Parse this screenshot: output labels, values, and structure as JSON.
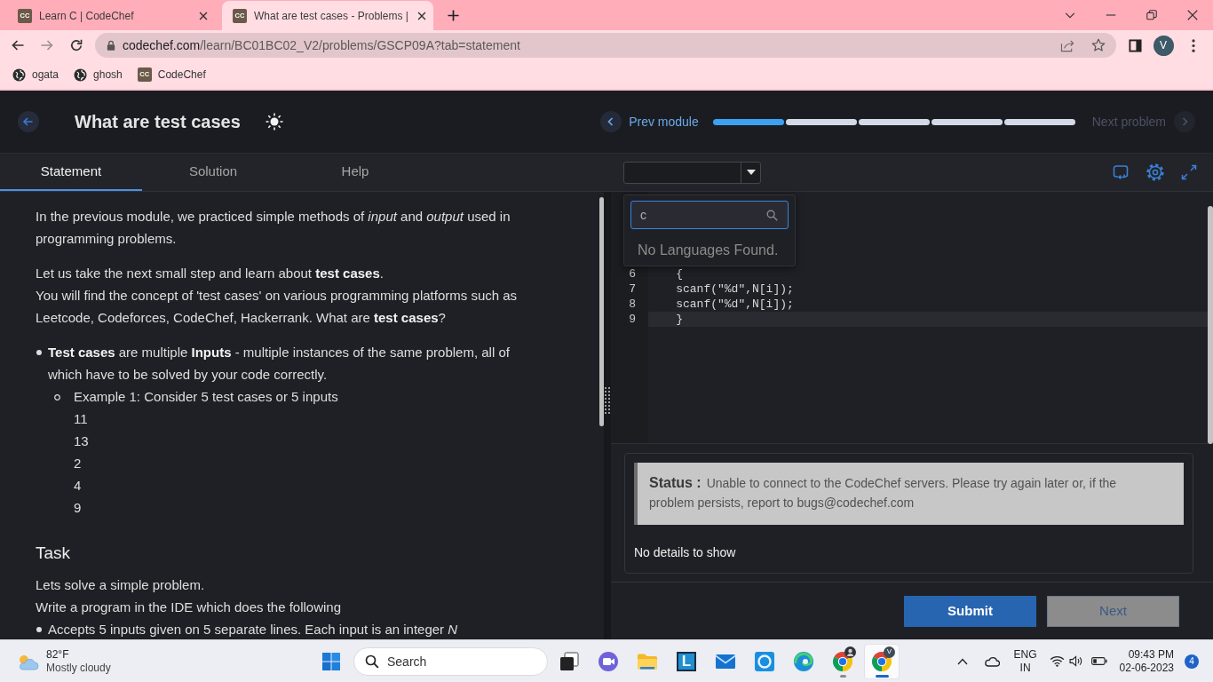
{
  "browser": {
    "tabs": [
      {
        "favicon": "CC",
        "title": "Learn C | CodeChef",
        "selected": false
      },
      {
        "favicon": "CC",
        "title": "What are test cases - Problems |",
        "selected": true
      }
    ],
    "forward_disabled": true,
    "address": {
      "host": "codechef.com",
      "path": "/learn/BC01BC02_V2/problems/GSCP09A?tab=statement"
    },
    "profile_initial": "V",
    "bookmarks": [
      {
        "kind": "globe",
        "label": "ogata"
      },
      {
        "kind": "globe",
        "label": "ghosh"
      },
      {
        "kind": "logo",
        "favicon": "CC",
        "label": "CodeChef"
      }
    ]
  },
  "header": {
    "title": "What are test cases",
    "prev_label": "Prev module",
    "progress": [
      {
        "done": true
      },
      {
        "done": false
      },
      {
        "done": false
      },
      {
        "done": false
      },
      {
        "done": false
      }
    ],
    "next_label": "Next problem",
    "next_disabled": true
  },
  "tabs": [
    {
      "label": "Statement",
      "selected": true
    },
    {
      "label": "Solution",
      "selected": false
    },
    {
      "label": "Help",
      "selected": false
    }
  ],
  "statement": [
    {
      "kind": "paragraph",
      "lines": [
        "In the previous module, we practiced simple methods of *input* and *output* used in programming problems."
      ]
    },
    {
      "kind": "paragraph",
      "lines": [
        "Let us take the next small step and learn about **test cases**.",
        "You will find the concept of 'test cases' on various programming platforms such as Leetcode, Codeforces, CodeChef, Hackerrank. What are **test cases**?"
      ]
    },
    {
      "kind": "list",
      "items": [
        {
          "text": "**Test cases** are multiple **Inputs** - multiple instances of the same problem, all of which have to be solved by your code correctly.",
          "children": [
            {
              "text": "Example 1: Consider 5 test cases or 5 inputs",
              "values": [
                "11",
                "13",
                "2",
                "4",
                "9"
              ]
            }
          ]
        }
      ]
    },
    {
      "kind": "heading",
      "text": "Task"
    },
    {
      "kind": "paragraph",
      "lines": [
        "Lets solve a simple problem.",
        "Write a program in the IDE which does the following"
      ]
    },
    {
      "kind": "list",
      "items": [
        {
          "text": "Accepts 5 inputs given on 5 separate lines. Each input is an integer *N*"
        }
      ]
    }
  ],
  "editor": {
    "language_popup": {
      "search_value": "c",
      "empty_message": "No Languages Found."
    },
    "lines": [
      {
        "number": "6",
        "text": "    {",
        "current": false
      },
      {
        "number": "7",
        "text": "    scanf(\"%d\",N[i]);",
        "current": false
      },
      {
        "number": "8",
        "text": "    scanf(\"%d\",N[i]);",
        "current": false
      },
      {
        "number": "9",
        "text": "    }",
        "current": true
      }
    ]
  },
  "status": {
    "label": "Status :",
    "message": "Unable to connect to the CodeChef servers. Please try again later or, if the problem persists, report to bugs@codechef.com",
    "details": "No details to show"
  },
  "buttons": [
    {
      "label": "Submit",
      "kind": "primary",
      "disabled": false
    },
    {
      "label": "Next",
      "kind": "secondary",
      "disabled": true
    }
  ],
  "taskbar": {
    "weather": {
      "temperature": "82°F",
      "condition": "Mostly cloudy"
    },
    "search_placeholder": "Search",
    "apps": [
      {
        "kind": "task_view",
        "running": false,
        "selected": false
      },
      {
        "kind": "video",
        "running": false,
        "selected": false
      },
      {
        "kind": "folder",
        "running": false,
        "selected": false
      },
      {
        "kind": "letter",
        "letter": "L",
        "running": false,
        "selected": false
      },
      {
        "kind": "mail",
        "running": false,
        "selected": false
      },
      {
        "kind": "ring",
        "running": false,
        "selected": false
      },
      {
        "kind": "wave_browser",
        "running": false,
        "selected": false
      },
      {
        "kind": "browser",
        "badge": {
          "kind": "person"
        },
        "running": true,
        "selected": false
      },
      {
        "kind": "browser",
        "badge": {
          "kind": "initial",
          "text": "V"
        },
        "running": true,
        "selected": true
      }
    ],
    "tray": {
      "language": "ENG",
      "region": "IN",
      "time": "09:43 PM",
      "date": "02-06-2023",
      "notifications": "4"
    }
  }
}
